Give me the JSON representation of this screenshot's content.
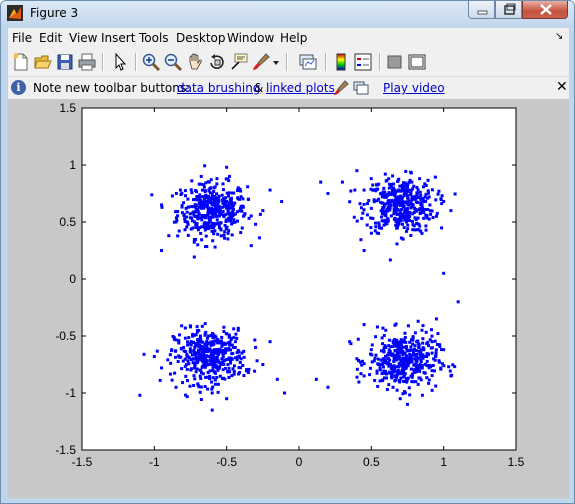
{
  "window": {
    "title": "Figure 3"
  },
  "menu": [
    "File",
    "Edit",
    "View",
    "Insert",
    "Tools",
    "Desktop",
    "Window",
    "Help"
  ],
  "toolbar": {
    "icons": [
      "new-file-icon",
      "open-folder-icon",
      "save-icon",
      "print-icon",
      "pointer-icon",
      "zoom-in-icon",
      "zoom-out-icon",
      "pan-hand-icon",
      "rotate-3d-icon",
      "data-cursor-icon",
      "brush-icon",
      "dropdown-arrow-icon",
      "link-plot-icon",
      "colorbar-icon",
      "legend-icon",
      "hide-plot-tools-icon",
      "show-plot-tools-icon"
    ]
  },
  "infobar": {
    "text": "Note new toolbar buttons:",
    "link1": "data brushing",
    "amp": "&",
    "link2": "linked plots",
    "video": "Play video",
    "close": "✕"
  },
  "colors": {
    "marker": "#0000ff",
    "figure_bg": "#c8c8c8",
    "axes_bg": "#ffffff"
  },
  "chart_data": {
    "type": "scatter",
    "title": "",
    "xlabel": "",
    "ylabel": "",
    "xlim": [
      -1.5,
      1.5
    ],
    "ylim": [
      -1.5,
      1.5
    ],
    "xticks": [
      "-1.5",
      "-1",
      "-0.5",
      "0",
      "0.5",
      "1",
      "1.5"
    ],
    "yticks": [
      "-1.5",
      "-1",
      "-0.5",
      "0",
      "0.5",
      "1",
      "1.5"
    ],
    "grid": false,
    "marker": ".",
    "series": [
      {
        "cluster_center": [
          -0.6,
          0.6
        ],
        "spread": 0.12,
        "points": [
          [
            -0.6,
            0.6
          ],
          [
            -0.72,
            0.55
          ],
          [
            -0.5,
            0.68
          ],
          [
            -0.65,
            0.72
          ],
          [
            -0.45,
            0.52
          ],
          [
            -0.78,
            0.62
          ],
          [
            -0.55,
            0.45
          ],
          [
            -0.68,
            0.4
          ],
          [
            -0.4,
            0.62
          ],
          [
            -0.85,
            0.5
          ],
          [
            -0.62,
            0.85
          ],
          [
            -0.35,
            0.7
          ],
          [
            -0.9,
            0.38
          ],
          [
            -0.3,
            0.48
          ],
          [
            -0.7,
            0.3
          ],
          [
            -0.48,
            0.9
          ],
          [
            -0.95,
            0.65
          ],
          [
            -0.25,
            0.6
          ],
          [
            -0.58,
            0.28
          ],
          [
            -0.42,
            0.8
          ],
          [
            -0.12,
            0.68
          ],
          [
            -0.2,
            0.78
          ],
          [
            -0.82,
            0.78
          ],
          [
            -0.5,
            0.98
          ],
          [
            -0.95,
            0.25
          ]
        ]
      },
      {
        "cluster_center": [
          0.7,
          0.65
        ],
        "spread": 0.12,
        "points": [
          [
            0.7,
            0.65
          ],
          [
            0.6,
            0.58
          ],
          [
            0.8,
            0.7
          ],
          [
            0.65,
            0.78
          ],
          [
            0.75,
            0.52
          ],
          [
            0.55,
            0.7
          ],
          [
            0.85,
            0.6
          ],
          [
            0.68,
            0.45
          ],
          [
            0.9,
            0.72
          ],
          [
            0.5,
            0.62
          ],
          [
            0.62,
            0.88
          ],
          [
            0.95,
            0.55
          ],
          [
            0.78,
            0.85
          ],
          [
            0.45,
            0.78
          ],
          [
            1.0,
            0.68
          ],
          [
            0.72,
            0.35
          ],
          [
            0.55,
            0.4
          ],
          [
            0.4,
            0.95
          ],
          [
            1.05,
            0.6
          ],
          [
            0.85,
            0.4
          ],
          [
            0.3,
            0.85
          ],
          [
            0.15,
            0.85
          ],
          [
            0.2,
            0.75
          ],
          [
            0.45,
            0.25
          ],
          [
            1.0,
            0.05
          ]
        ]
      },
      {
        "cluster_center": [
          -0.62,
          -0.68
        ],
        "spread": 0.12,
        "points": [
          [
            -0.62,
            -0.68
          ],
          [
            -0.72,
            -0.6
          ],
          [
            -0.52,
            -0.75
          ],
          [
            -0.68,
            -0.8
          ],
          [
            -0.48,
            -0.58
          ],
          [
            -0.8,
            -0.72
          ],
          [
            -0.58,
            -0.5
          ],
          [
            -0.7,
            -0.92
          ],
          [
            -0.4,
            -0.7
          ],
          [
            -0.88,
            -0.62
          ],
          [
            -0.6,
            -1.0
          ],
          [
            -0.35,
            -0.82
          ],
          [
            -0.95,
            -0.78
          ],
          [
            -0.3,
            -0.6
          ],
          [
            -0.75,
            -0.42
          ],
          [
            -0.5,
            -1.05
          ],
          [
            -1.0,
            -0.68
          ],
          [
            -0.25,
            -0.75
          ],
          [
            -0.6,
            -1.15
          ],
          [
            -0.42,
            -0.45
          ],
          [
            -1.1,
            -1.02
          ],
          [
            -0.15,
            -0.88
          ],
          [
            -0.1,
            -1.0
          ],
          [
            -0.2,
            -0.55
          ],
          [
            -0.85,
            -0.95
          ]
        ]
      },
      {
        "cluster_center": [
          0.72,
          -0.72
        ],
        "spread": 0.12,
        "points": [
          [
            0.72,
            -0.72
          ],
          [
            0.62,
            -0.65
          ],
          [
            0.82,
            -0.8
          ],
          [
            0.68,
            -0.58
          ],
          [
            0.78,
            -0.9
          ],
          [
            0.55,
            -0.75
          ],
          [
            0.88,
            -0.68
          ],
          [
            0.65,
            -0.95
          ],
          [
            0.92,
            -0.55
          ],
          [
            0.5,
            -0.62
          ],
          [
            0.7,
            -1.05
          ],
          [
            0.98,
            -0.78
          ],
          [
            0.45,
            -0.85
          ],
          [
            0.85,
            -0.45
          ],
          [
            1.0,
            -0.62
          ],
          [
            0.6,
            -0.45
          ],
          [
            0.4,
            -0.7
          ],
          [
            0.95,
            -0.35
          ],
          [
            0.75,
            -1.1
          ],
          [
            1.05,
            -0.85
          ],
          [
            0.35,
            -0.55
          ],
          [
            1.1,
            -0.2
          ],
          [
            0.2,
            -0.95
          ],
          [
            0.12,
            -0.88
          ],
          [
            0.45,
            -0.4
          ]
        ]
      }
    ]
  }
}
